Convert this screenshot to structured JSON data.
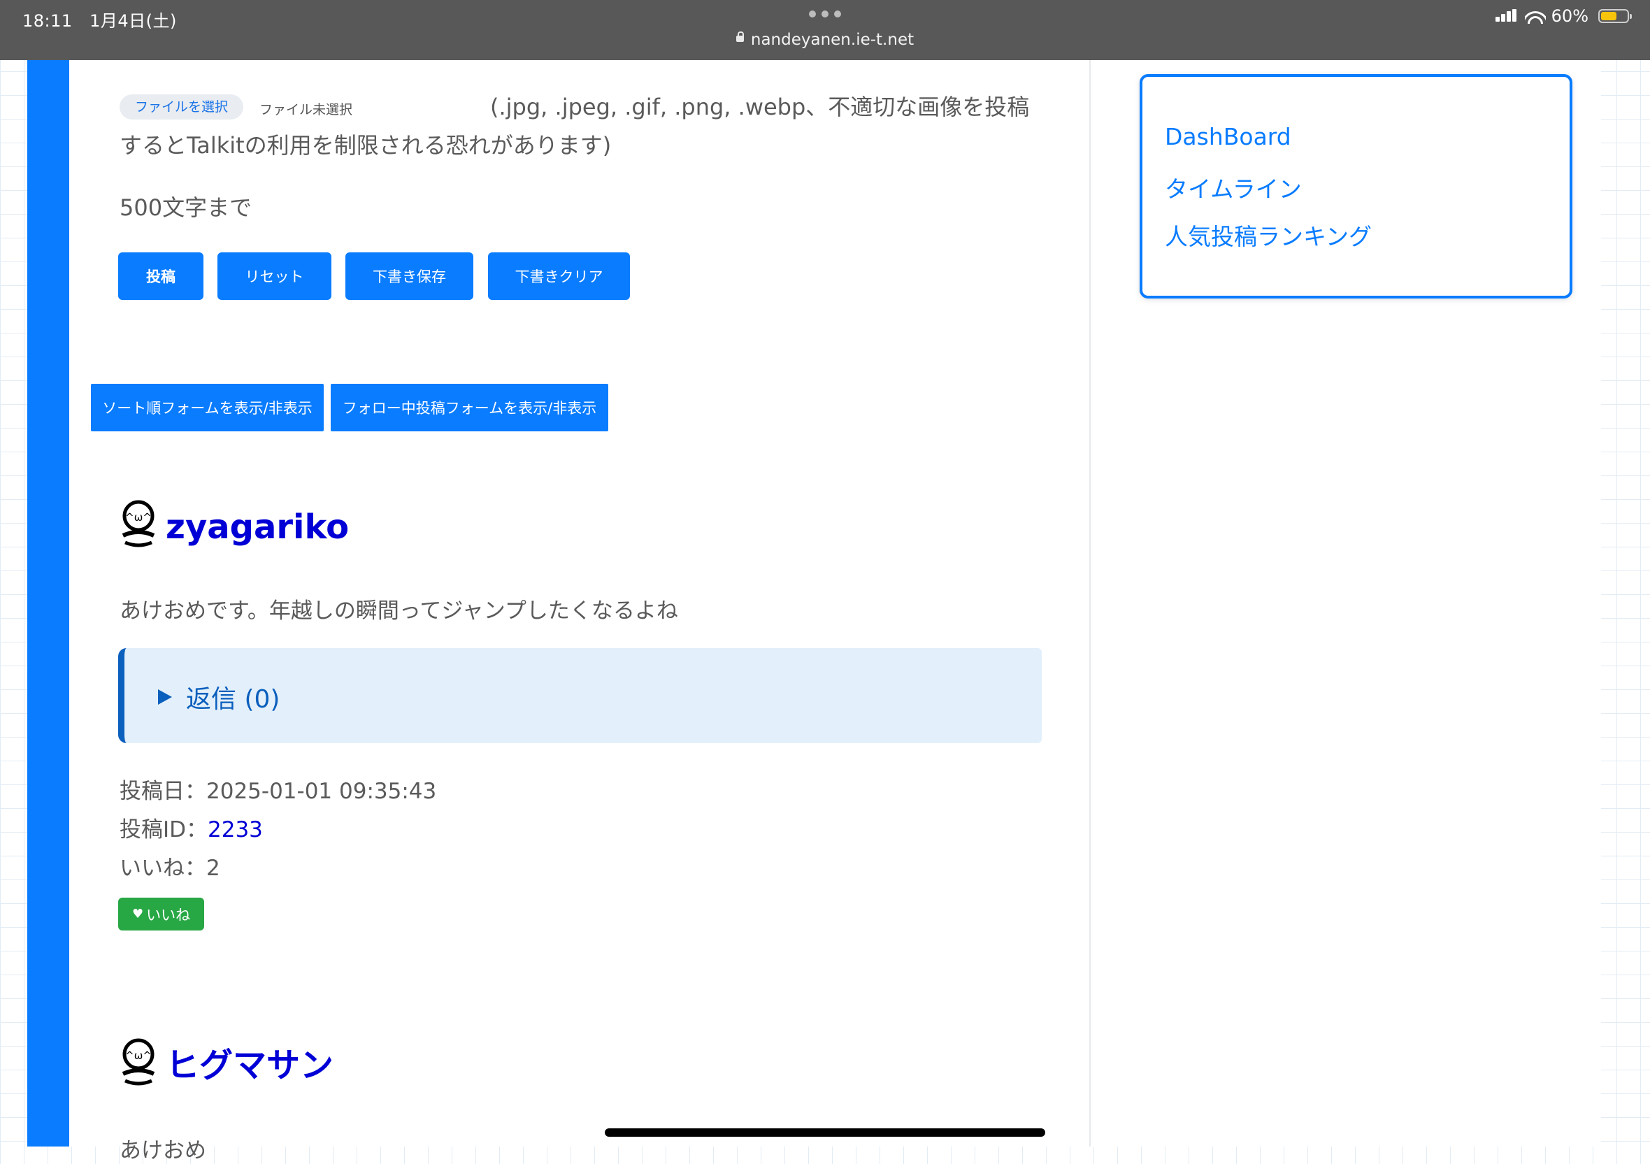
{
  "status_bar": {
    "time": "18:11",
    "date": "1月4日(土)",
    "url": "nandeyanen.ie-t.net",
    "battery": "60%",
    "battery_level": 0.6,
    "battery_color": "#f7c40c"
  },
  "post_form": {
    "file_button_label": "ファイルを選択",
    "file_status": "ファイル未選択",
    "file_note": "(.jpg, .jpeg, .gif, .png, .webp、不適切な画像を投稿するとTalkitの利用を制限される恐れがあります)",
    "char_limit": "500文字まで",
    "buttons": {
      "post": "投稿",
      "reset": "リセット",
      "draft_save": "下書き保存",
      "draft_clear": "下書きクリア"
    }
  },
  "toggles": {
    "sort_form": "ソート順フォームを表示/非表示",
    "follow_form": "フォロー中投稿フォームを表示/非表示"
  },
  "posts": [
    {
      "author": "zyagariko",
      "body": "あけおめです。年越しの瞬間ってジャンプしたくなるよね",
      "reply_label": "返信 (0)",
      "date_label": "投稿日：",
      "date": "2025-01-01 09:35:43",
      "id_label": "投稿ID：",
      "id": "2233",
      "likes_label": "いいね：",
      "likes": "2",
      "like_button": "いいね",
      "avatar_icon": "kaomoji-avatar-icon"
    },
    {
      "author": "ヒグマサン",
      "body": "あけおめ",
      "avatar_icon": "kaomoji-avatar-icon"
    }
  ],
  "sidebar": {
    "links": [
      "DashBoard",
      "タイムライン",
      "人気投稿ランキング"
    ]
  },
  "colors": {
    "primary": "#0a7cff",
    "author_link": "#0000d6",
    "like": "#28a745",
    "reply_bg": "#e3f0fb",
    "reply_accent": "#0b5fbd"
  }
}
